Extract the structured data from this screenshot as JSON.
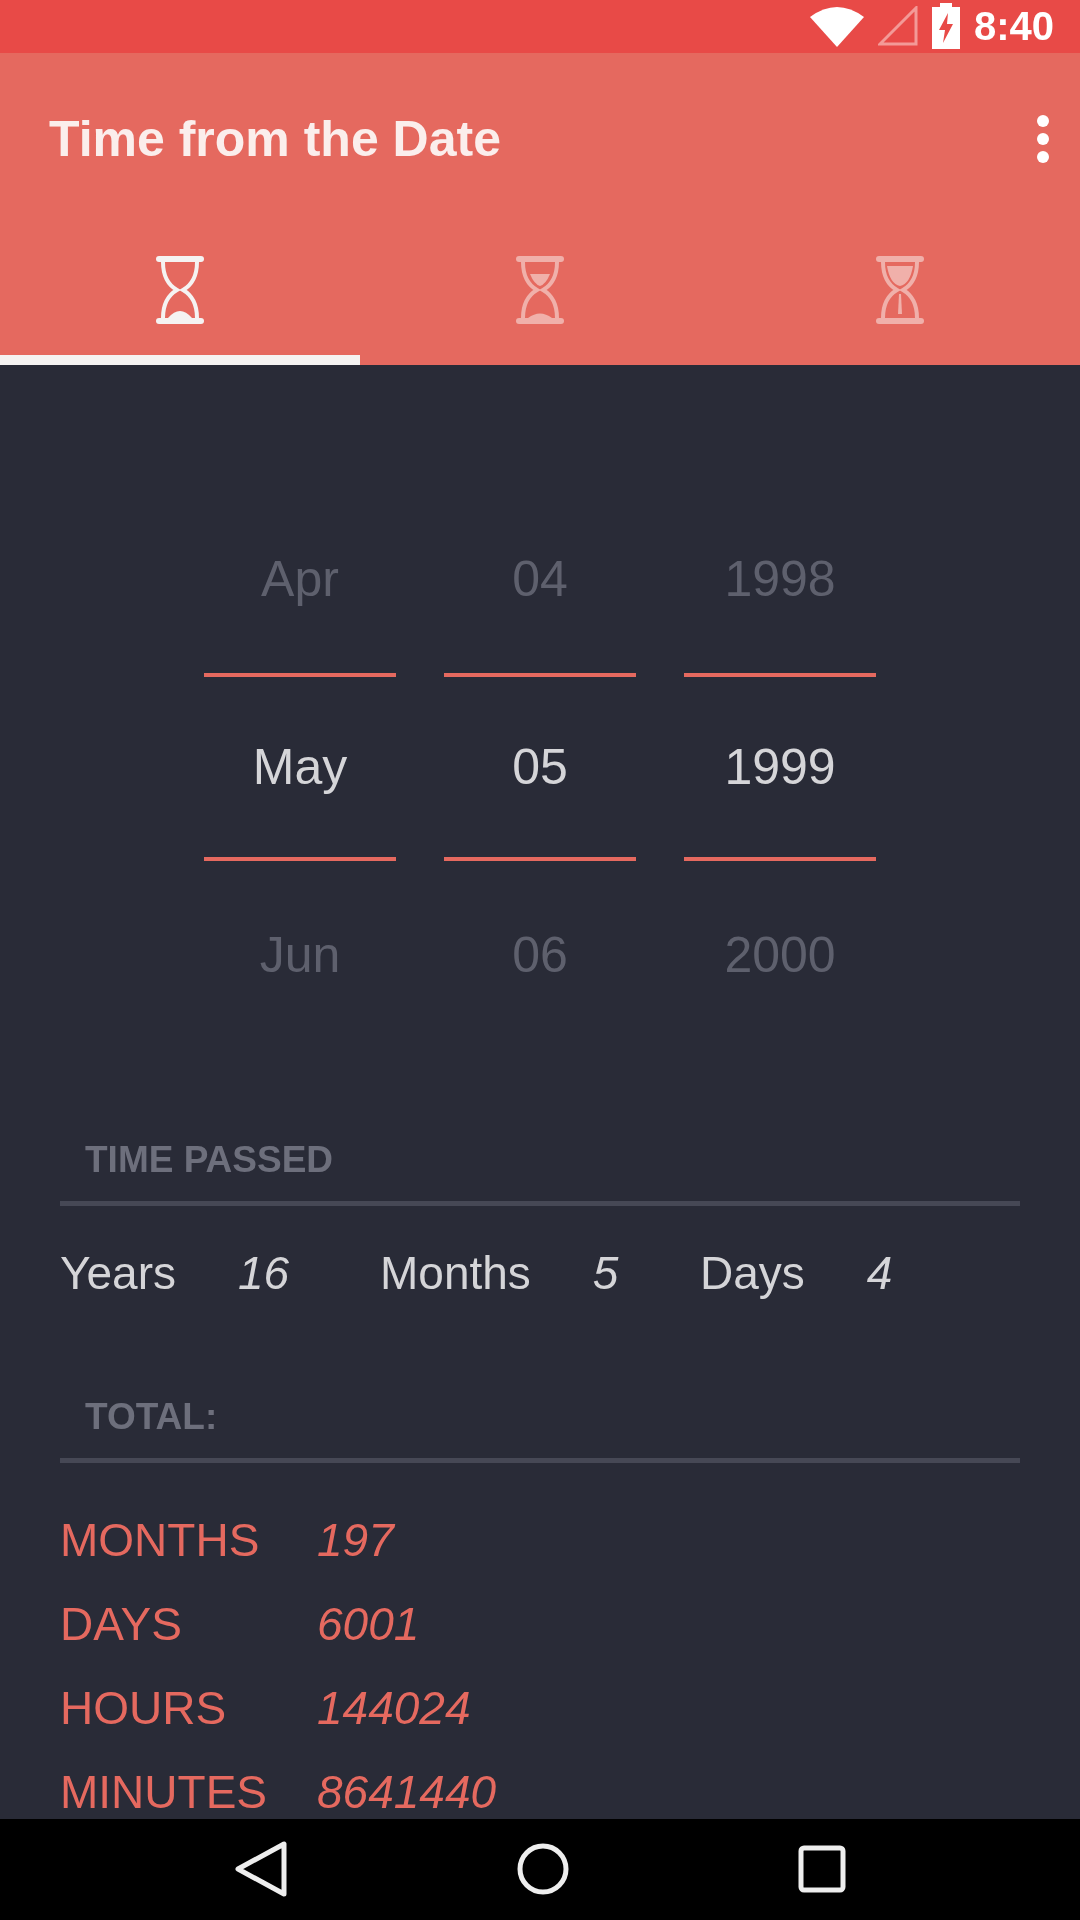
{
  "status_bar": {
    "time": "8:40"
  },
  "app_bar": {
    "title": "Time from the Date"
  },
  "tabs": [
    {
      "kind": "start",
      "selected": true
    },
    {
      "kind": "middle",
      "selected": false
    },
    {
      "kind": "end",
      "selected": false
    }
  ],
  "picker": [
    {
      "items": [
        {
          "label": "Apr",
          "selected": false
        },
        {
          "label": "May",
          "selected": true
        },
        {
          "label": "Jun",
          "selected": false
        }
      ]
    },
    {
      "items": [
        {
          "label": "04",
          "selected": false
        },
        {
          "label": "05",
          "selected": true
        },
        {
          "label": "06",
          "selected": false
        }
      ]
    },
    {
      "items": [
        {
          "label": "1998",
          "selected": false
        },
        {
          "label": "1999",
          "selected": true
        },
        {
          "label": "2000",
          "selected": false
        }
      ]
    }
  ],
  "time_passed": {
    "heading": "TIME PASSED",
    "values": [
      {
        "label": "Years",
        "value": "16"
      },
      {
        "label": "Months",
        "value": "5"
      },
      {
        "label": "Days",
        "value": "4"
      }
    ]
  },
  "total": {
    "heading": "TOTAL:",
    "rows": [
      {
        "label": "MONTHS",
        "value": "197"
      },
      {
        "label": "DAYS",
        "value": "6001"
      },
      {
        "label": "HOURS",
        "value": "144024"
      },
      {
        "label": "MINUTES",
        "value": "8641440"
      }
    ]
  }
}
